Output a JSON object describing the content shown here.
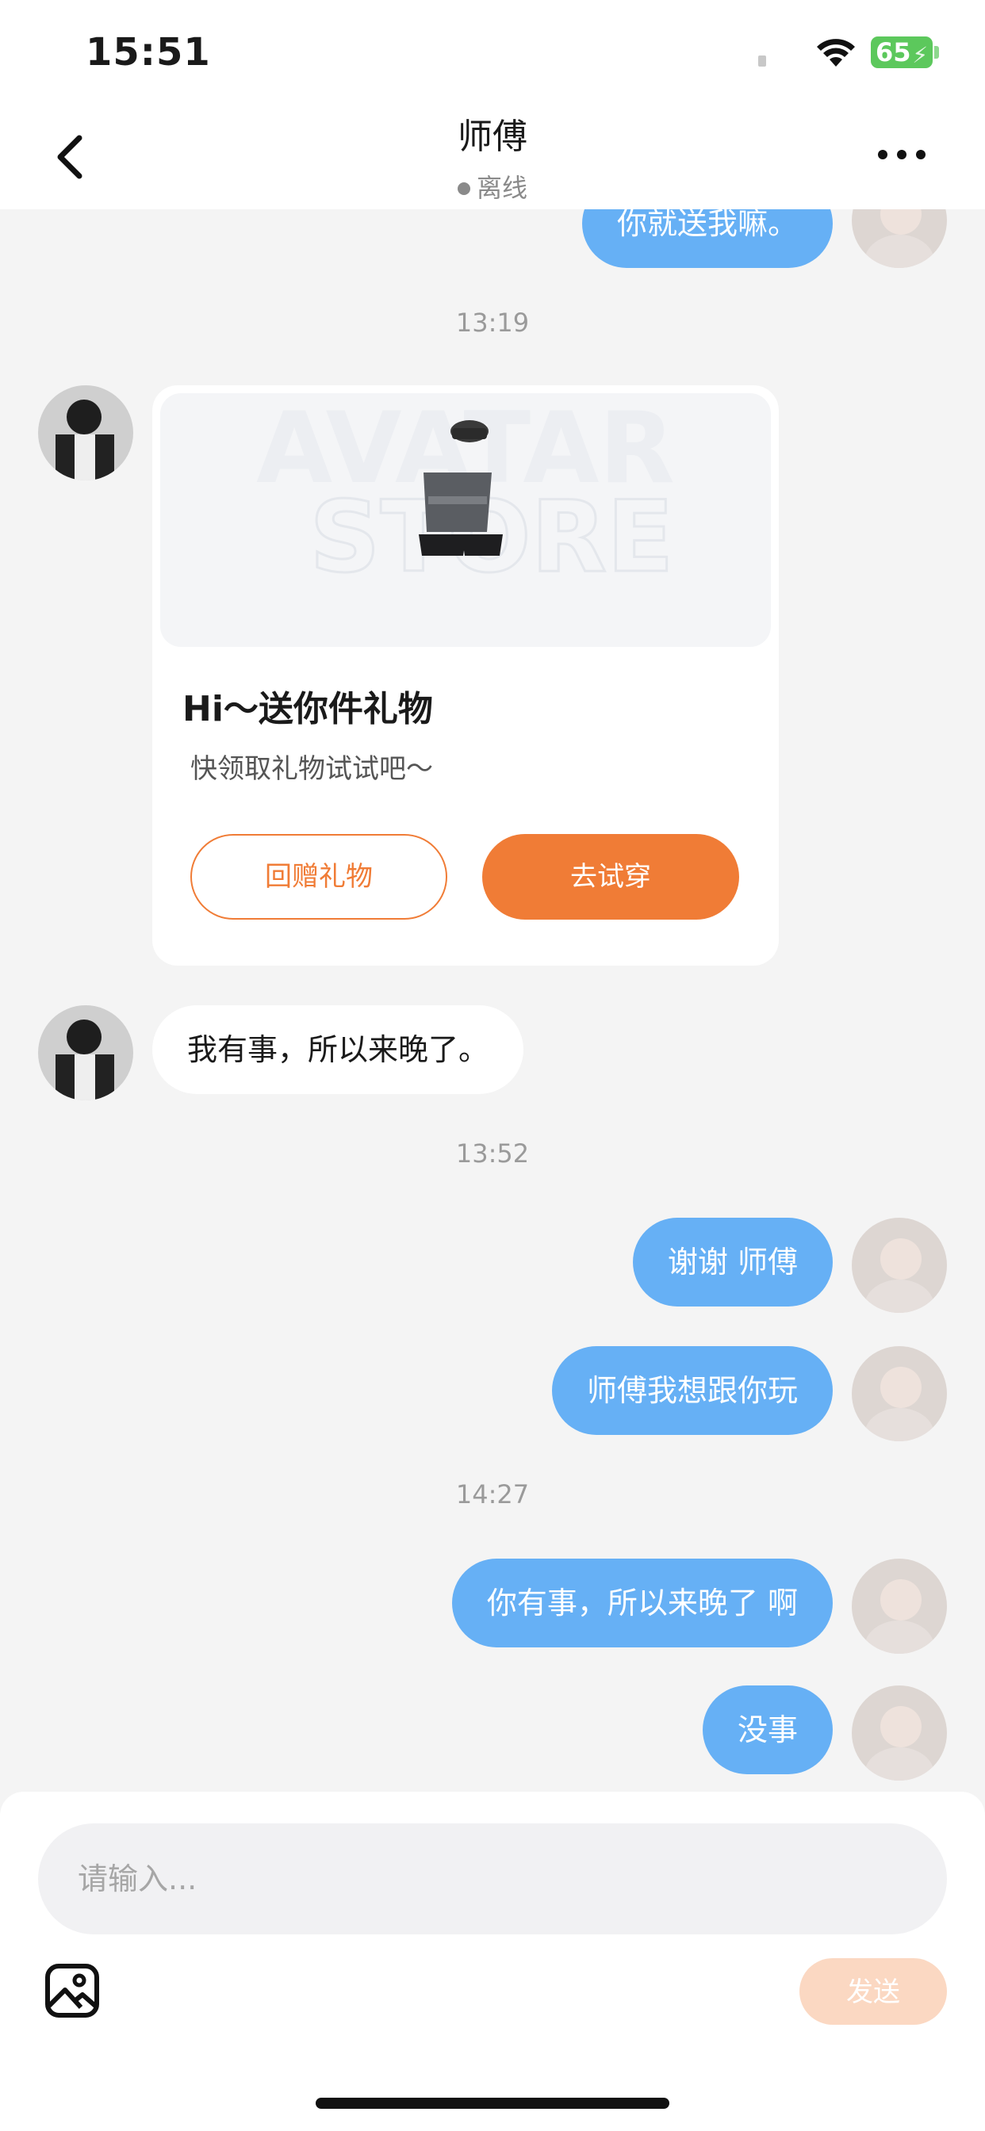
{
  "status_bar": {
    "time": "15:51",
    "battery": "65"
  },
  "header": {
    "title": "师傅",
    "presence": "离线"
  },
  "chat": {
    "partial_message": "你就送我嘛。",
    "timestamps": [
      "13:19",
      "13:52",
      "14:27"
    ],
    "gift_card": {
      "image_watermark_line1": "AVATAR",
      "image_watermark_line2": "STORE",
      "title": "Hi～送你件礼物",
      "subtitle": "快领取礼物试试吧～",
      "return_gift_label": "回赠礼物",
      "try_on_label": "去试穿"
    },
    "messages": [
      {
        "from": "other",
        "text": "我有事，所以来晚了。"
      },
      {
        "from": "me",
        "text": "谢谢 师傅"
      },
      {
        "from": "me",
        "text": "师傅我想跟你玩"
      },
      {
        "from": "me",
        "text": "你有事，所以来晚了 啊"
      },
      {
        "from": "me",
        "text": "没事"
      }
    ]
  },
  "input": {
    "placeholder": "请输入...",
    "send_label": "发送"
  },
  "colors": {
    "my_bubble": "#66b0f5",
    "accent": "#f07c36",
    "send_disabled": "#fbd8c2"
  }
}
